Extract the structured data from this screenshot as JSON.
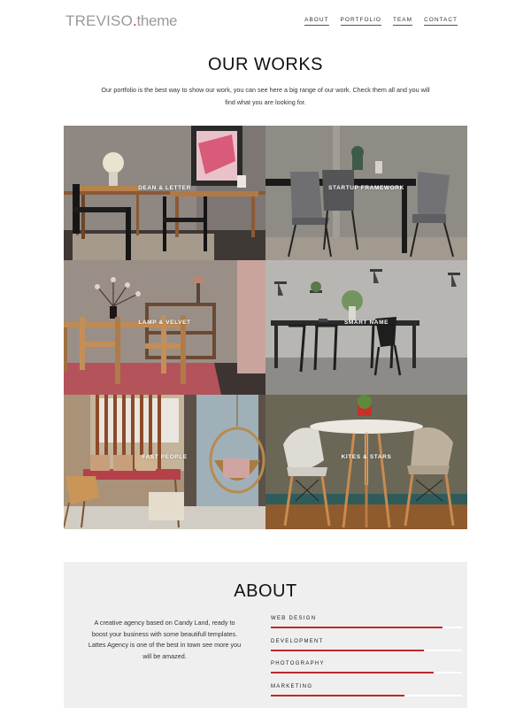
{
  "brand": {
    "name": "TREVISO",
    "suffix": "theme",
    "accent": "#c3322f"
  },
  "nav": [
    {
      "label": "ABOUT"
    },
    {
      "label": "PORTFOLIO"
    },
    {
      "label": "TEAM"
    },
    {
      "label": "CONTACT"
    }
  ],
  "works": {
    "title": "OUR WORKS",
    "description": "Our portfolio is the best way to show our work, you can see here a big range of our work. Check them all and you will find what you are looking for.",
    "items": [
      {
        "label": "DEAN & LETTER"
      },
      {
        "label": "STARTUP FRAMEWORK"
      },
      {
        "label": "LAMP & VELVET"
      },
      {
        "label": "SMART NAME"
      },
      {
        "label": "FAST PEOPLE"
      },
      {
        "label": "KITES & STARS"
      }
    ]
  },
  "about": {
    "title": "ABOUT",
    "text": "A creative agency based on Candy Land, ready to boost your business with some beautifull templates. Lattes Agency is one of the best in town see more you will be amazed.",
    "skills": [
      {
        "name": "WEB DESIGN",
        "level": 0.9
      },
      {
        "name": "DEVELOPMENT",
        "level": 0.8
      },
      {
        "name": "PHOTOGRAPHY",
        "level": 0.85
      },
      {
        "name": "MARKETING",
        "level": 0.7
      }
    ],
    "bar_color": "#c0282a"
  }
}
